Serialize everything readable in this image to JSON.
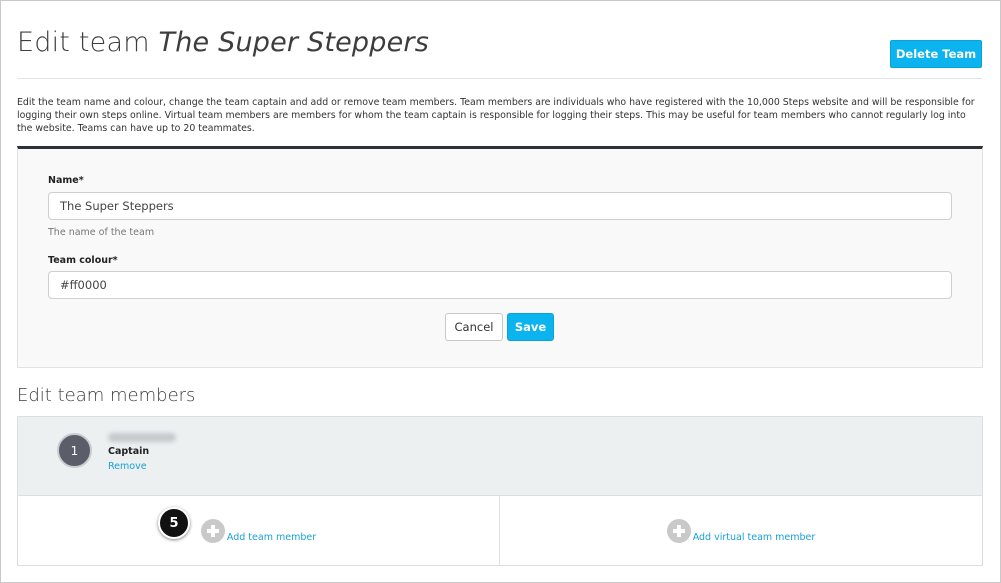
{
  "header": {
    "title_prefix": "Edit team",
    "team_name": "The Super Steppers",
    "delete_label": "Delete Team"
  },
  "intro": "Edit the team name and colour, change the team captain and add or remove team members. Team members are individuals who have registered with the 10,000 Steps website and will be responsible for logging their own steps online. Virtual team members are members for whom the team captain is responsible for logging their steps. This may be useful for team members who cannot regularly log into the website. Teams can have up to 20 teammates.",
  "form": {
    "name_label": "Name*",
    "name_value": "The Super Steppers",
    "name_help": "The name of the team",
    "colour_label": "Team colour*",
    "colour_value": "#ff0000",
    "cancel_label": "Cancel",
    "save_label": "Save"
  },
  "members": {
    "section_title": "Edit team members",
    "list": [
      {
        "number": "1",
        "role": "Captain",
        "remove_label": "Remove"
      }
    ],
    "add_member_label": "Add team member",
    "add_virtual_label": "Add virtual team member"
  },
  "annotation": {
    "step": "5"
  },
  "colors": {
    "accent": "#0bb4ee",
    "link": "#1a9fd6",
    "panel_top_border": "#2d3238",
    "member_row_bg": "#edf0f1"
  },
  "icons": {
    "add": "plus-circle-icon"
  }
}
